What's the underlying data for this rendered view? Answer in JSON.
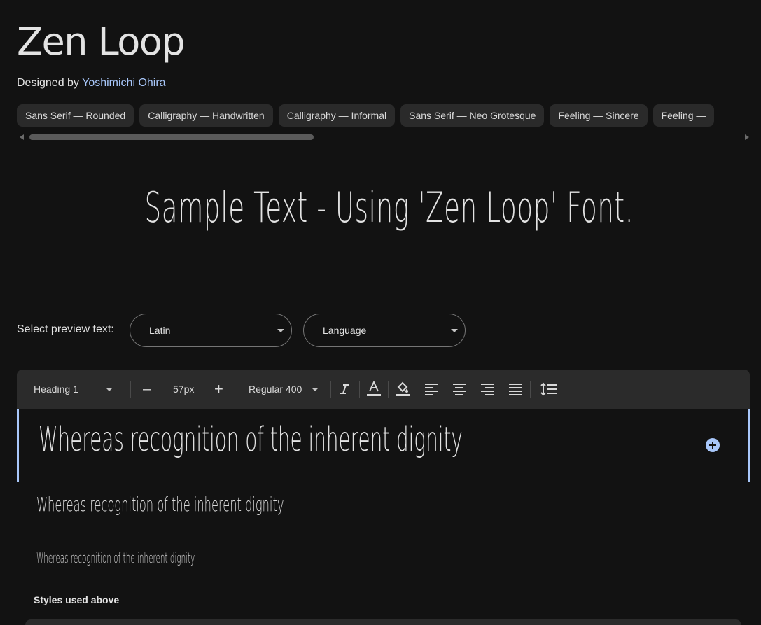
{
  "font": {
    "name": "Zen Loop",
    "designed_by_label": "Designed by",
    "designer": "Yoshimichi Ohira"
  },
  "tags": [
    "Sans Serif — Rounded",
    "Calligraphy — Handwritten",
    "Calligraphy — Informal",
    "Sans Serif — Neo Grotesque",
    "Feeling — Sincere",
    "Feeling — "
  ],
  "sample_text": "Sample Text - Using 'Zen Loop' Font.",
  "preview": {
    "label": "Select preview text:",
    "script_value": "Latin",
    "language_value": "Language"
  },
  "toolbar": {
    "style_value": "Heading 1",
    "minus": "–",
    "size_value": "57px",
    "plus": "+",
    "weight_value": "Regular 400"
  },
  "lines": {
    "heading1": "Whereas recognition of the inherent dignity",
    "heading2": "Whereas recognition of the inherent dignity",
    "heading3": "Whereas recognition of the inherent dignity"
  },
  "styles_used_label": "Styles used above",
  "colors": {
    "background": "#121212",
    "chip": "#2a2a2a",
    "accent": "#a8c7fa",
    "toolbar": "#2b2b2b"
  },
  "icons": {
    "italic": "italic-icon",
    "text_color": "text-color-icon",
    "highlight": "highlight-icon",
    "align_left": "align-left-icon",
    "align_center": "align-center-icon",
    "align_right": "align-right-icon",
    "align_justify": "align-justify-icon",
    "line_spacing": "line-spacing-icon",
    "add": "add-circle-icon"
  }
}
